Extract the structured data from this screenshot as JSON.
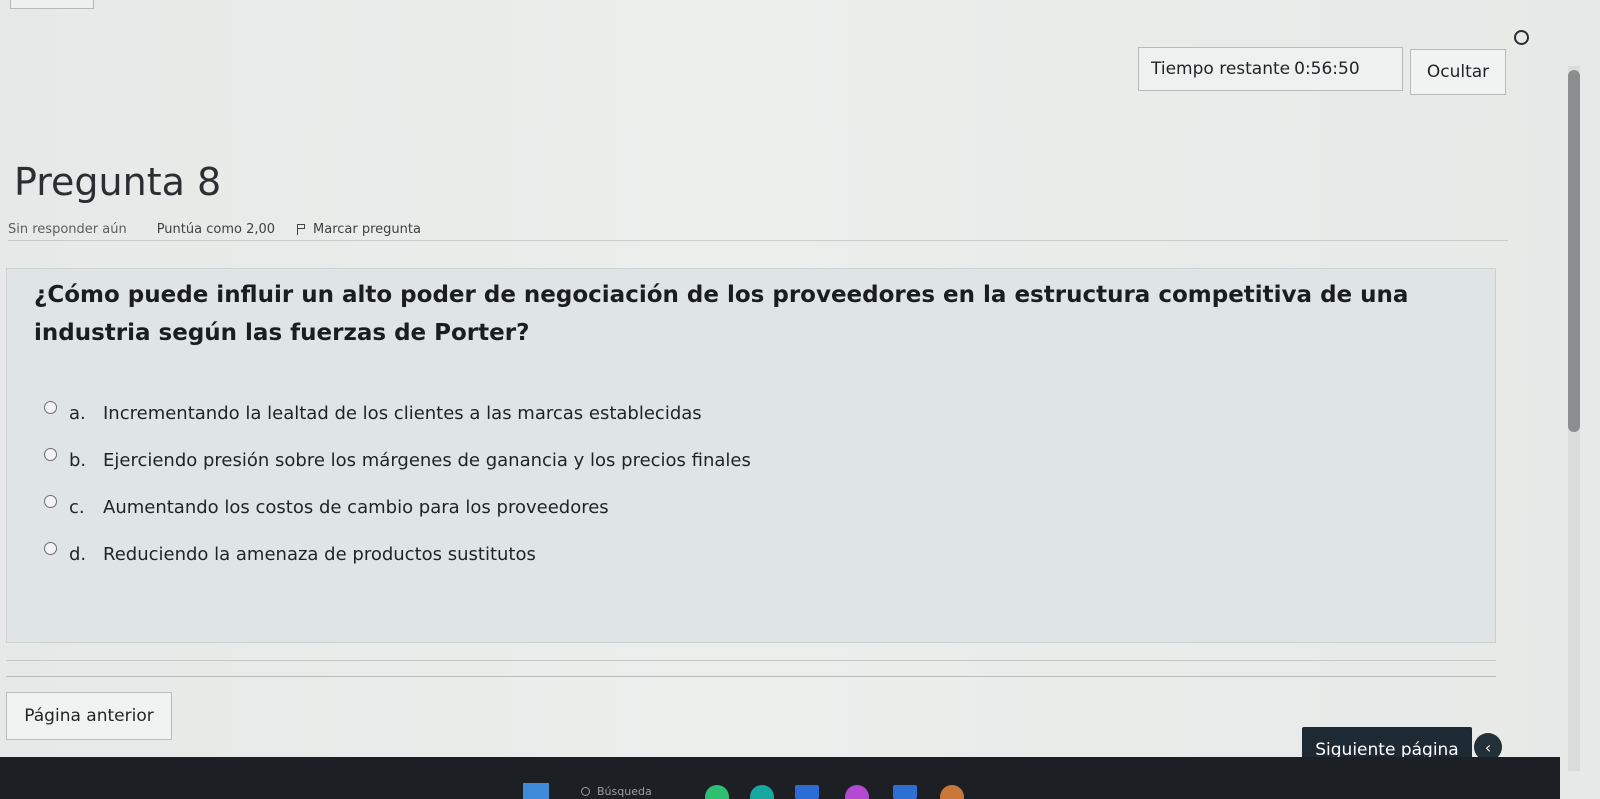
{
  "timer": {
    "label": "Tiempo restante",
    "value": "0:56:50"
  },
  "hide_label": "Ocultar",
  "question": {
    "title": "Pregunta 8",
    "status": "Sin responder aún",
    "score": "Puntúa como 2,00",
    "flag_label": "Marcar pregunta",
    "text": "¿Cómo puede influir un alto poder de negociación de los proveedores en la estructura competitiva de una industria según las fuerzas de Porter?",
    "options": [
      {
        "letter": "a.",
        "text": "Incrementando la lealtad de los clientes a las marcas establecidas"
      },
      {
        "letter": "b.",
        "text": "Ejerciendo presión sobre los márgenes de ganancia y los precios finales"
      },
      {
        "letter": "c.",
        "text": "Aumentando los costos de cambio para los proveedores"
      },
      {
        "letter": "d.",
        "text": "Reduciendo la amenaza de productos sustitutos"
      }
    ]
  },
  "nav": {
    "prev_label": "Página anterior",
    "next_label": "Siguiente página",
    "collapse_glyph": "‹"
  },
  "taskbar": {
    "search_placeholder": "Búsqueda"
  },
  "colors": {
    "primary_button": "#1e2a33",
    "question_bg": "#dfe5e4",
    "page_bg": "#e9ecea",
    "taskbar": "#1c1f24"
  }
}
